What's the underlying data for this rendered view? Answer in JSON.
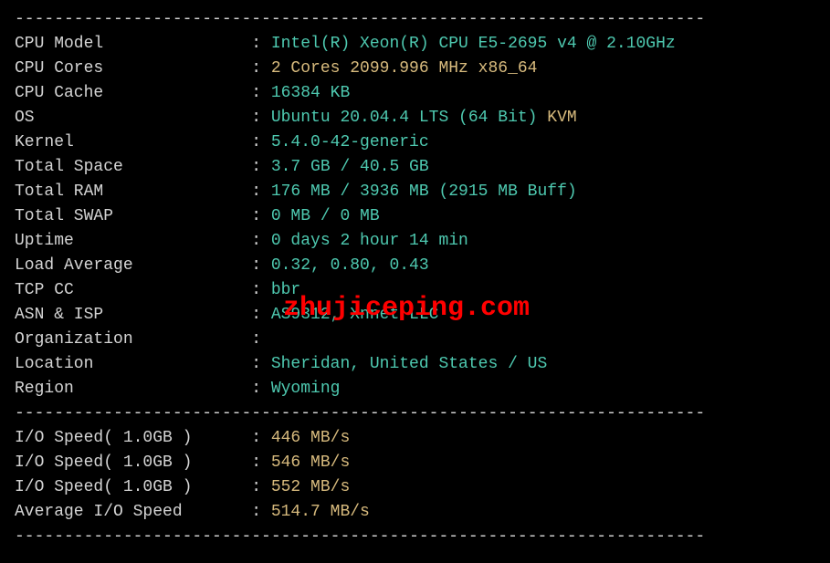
{
  "separator": "----------------------------------------------------------------------",
  "rows": [
    {
      "label": "CPU Model",
      "segments": [
        {
          "text": "Intel(R) Xeon(R) CPU E5-2695 v4 @ 2.10GHz",
          "class": "value"
        }
      ]
    },
    {
      "label": "CPU Cores",
      "segments": [
        {
          "text": "2 Cores 2099.996 MHz x86_64",
          "class": "yellow"
        }
      ]
    },
    {
      "label": "CPU Cache",
      "segments": [
        {
          "text": "16384 KB",
          "class": "value"
        }
      ]
    },
    {
      "label": "OS",
      "segments": [
        {
          "text": "Ubuntu 20.04.4 LTS (64 Bit) ",
          "class": "value"
        },
        {
          "text": "KVM",
          "class": "yellow"
        }
      ]
    },
    {
      "label": "Kernel",
      "segments": [
        {
          "text": "5.4.0-42-generic",
          "class": "value"
        }
      ]
    },
    {
      "label": "Total Space",
      "segments": [
        {
          "text": "3.7 GB / 40.5 GB",
          "class": "value"
        }
      ]
    },
    {
      "label": "Total RAM",
      "segments": [
        {
          "text": "176 MB / 3936 MB (2915 MB Buff)",
          "class": "value"
        }
      ]
    },
    {
      "label": "Total SWAP",
      "segments": [
        {
          "text": "0 MB / 0 MB",
          "class": "value"
        }
      ]
    },
    {
      "label": "Uptime",
      "segments": [
        {
          "text": "0 days 2 hour 14 min",
          "class": "value"
        }
      ]
    },
    {
      "label": "Load Average",
      "segments": [
        {
          "text": "0.32, 0.80, 0.43",
          "class": "value"
        }
      ]
    },
    {
      "label": "TCP CC",
      "segments": [
        {
          "text": "bbr",
          "class": "value"
        }
      ]
    },
    {
      "label": "ASN & ISP",
      "segments": [
        {
          "text": "AS9312, Xnnet LLC",
          "class": "value"
        }
      ]
    },
    {
      "label": "Organization",
      "segments": []
    },
    {
      "label": "Location",
      "segments": [
        {
          "text": "Sheridan, United States / US",
          "class": "value"
        }
      ]
    },
    {
      "label": "Region",
      "segments": [
        {
          "text": "Wyoming",
          "class": "value"
        }
      ]
    }
  ],
  "io_rows": [
    {
      "label": "I/O Speed( 1.0GB )",
      "value": "446 MB/s"
    },
    {
      "label": "I/O Speed( 1.0GB )",
      "value": "546 MB/s"
    },
    {
      "label": "I/O Speed( 1.0GB )",
      "value": "552 MB/s"
    },
    {
      "label": "Average I/O Speed",
      "value": "514.7 MB/s"
    }
  ],
  "watermark": "zhujiceping.com"
}
